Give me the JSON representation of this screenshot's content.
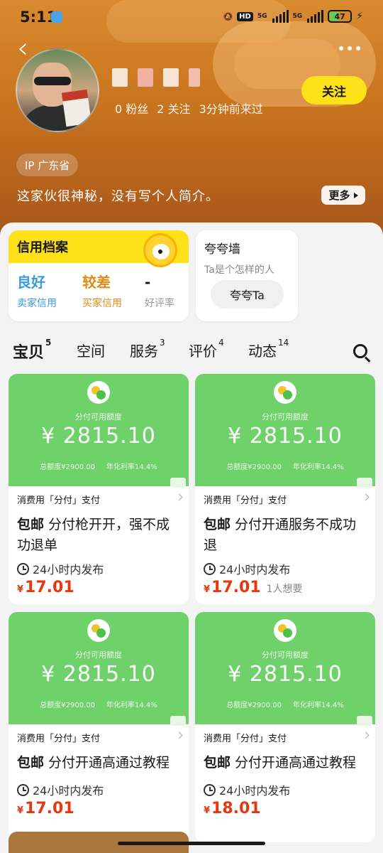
{
  "status_bar": {
    "time": "5:11",
    "hd_label": "HD",
    "sim1_label": "5G",
    "sim2_label": "5G",
    "battery": "47"
  },
  "profile": {
    "stats": {
      "fans": "0 粉丝",
      "following": "2 关注",
      "last_seen": "3分钟前来过"
    },
    "follow_label": "关注",
    "ip_label": "IP 广东省",
    "bio": "这家伙很神秘，没有写个人简介。",
    "more_label": "更多"
  },
  "credit": {
    "title": "信用档案",
    "seller": {
      "value": "良好",
      "label": "卖家信用"
    },
    "buyer": {
      "value": "较差",
      "label": "买家信用"
    },
    "rating": {
      "value": "-",
      "label": "好评率"
    }
  },
  "praise_wall": {
    "title": "夸夸墙",
    "subtitle": "Ta是个怎样的人",
    "button": "夸夸Ta"
  },
  "tabs": [
    {
      "label": "宝贝",
      "count": "5"
    },
    {
      "label": "空间",
      "count": ""
    },
    {
      "label": "服务",
      "count": "3"
    },
    {
      "label": "评价",
      "count": "4"
    },
    {
      "label": "动态",
      "count": "14"
    }
  ],
  "products": [
    {
      "avail_label": "分付可用额度",
      "amount": "¥ 2815.10",
      "total": "总额度¥2900.00",
      "rate": "年化利率14.4%",
      "caption": "消费用「分付」支付",
      "tag": "包邮",
      "title": "分付枪开开，强不成功退单",
      "time": "24小时内发布",
      "currency": "¥",
      "price": "17.01",
      "wants": ""
    },
    {
      "avail_label": "分付可用额度",
      "amount": "¥ 2815.10",
      "total": "总额度¥2900.00",
      "rate": "年化利率14.4%",
      "caption": "消费用「分付」支付",
      "tag": "包邮",
      "title": "分付开通服务不成功退",
      "time": "24小时内发布",
      "currency": "¥",
      "price": "17.01",
      "wants": "1人想要"
    },
    {
      "avail_label": "分付可用额度",
      "amount": "¥ 2815.10",
      "total": "总额度¥2900.00",
      "rate": "年化利率14.4%",
      "caption": "消费用「分付」支付",
      "tag": "包邮",
      "title": "分付开通高通过教程",
      "time": "24小时内发布",
      "currency": "¥",
      "price": "17.01",
      "wants": ""
    },
    {
      "avail_label": "分付可用额度",
      "amount": "¥ 2815.10",
      "total": "总额度¥2900.00",
      "rate": "年化利率14.4%",
      "caption": "消费用「分付」支付",
      "tag": "包邮",
      "title": "分付开通高通过教程",
      "time": "24小时内发布",
      "currency": "¥",
      "price": "18.01",
      "wants": ""
    }
  ],
  "colors": {
    "accent_yellow": "#ffe11a",
    "price_red": "#e8360f",
    "card_green": "#6fd16a",
    "seller_good": "#3a9bdc",
    "buyer_poor": "#e08b16"
  },
  "icons": [
    "back-icon",
    "more-icon",
    "search-icon",
    "clock-icon",
    "pay-logo-icon",
    "mascot-icon"
  ]
}
